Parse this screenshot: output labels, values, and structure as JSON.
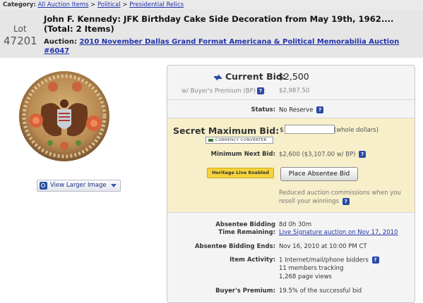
{
  "breadcrumb": {
    "label": "Category:",
    "items": [
      "All Auction Items",
      "Political",
      "Presidential Relics"
    ],
    "separator": ">"
  },
  "lot": {
    "label": "Lot",
    "number": "47201",
    "title": "John F. Kennedy: JFK Birthday Cake Side Decoration from May 19th, 1962.... (Total: 2 Items)",
    "auction_label": "Auction:",
    "auction_name": "2010 November Dallas Grand Format Americana & Political Memorabilia Auction #6047"
  },
  "image": {
    "view_larger_label": "View Larger Image"
  },
  "bid": {
    "current_label": "Current Bid:",
    "current_value": "$2,500",
    "bp_label": "w/ Buyer's Premium (BP)",
    "bp_value": "$2,987.50",
    "status_label": "Status:",
    "status_value": "No Reserve",
    "secret_label": "Secret Maximum Bid:",
    "dollar_sign": "$",
    "secret_input_value": "",
    "whole_dollars": "(whole dollars)",
    "currency_converter": "CURRENCY CONVERTER",
    "min_label": "Minimum Next Bid:",
    "min_value": "$2,600 ($3,107.00 w/ BP)",
    "heritage_live": "Heritage Live Enabled",
    "place_bid_button": "Place Absentee Bid",
    "reduced_commission": "Reduced auction commissions when you resell your winnings",
    "absentee_label_1": "Absentee Bidding",
    "absentee_label_2": "Time Remaining:",
    "absentee_value": "8d 0h 30m",
    "live_link": "Live Signature auction on Nov 17, 2010",
    "ends_label": "Absentee Bidding Ends:",
    "ends_value": "Nov 16, 2010 at 10:00 PM CT",
    "activity_label": "Item Activity:",
    "activity_bidders": "1 Internet/mail/phone bidders",
    "activity_tracking": "11 members tracking",
    "activity_views": "1,268 page views",
    "bp2_label": "Buyer's Premium:",
    "bp2_value": "19.5% of the successful bid",
    "help_glyph": "?"
  },
  "colors": {
    "link": "#2233aa",
    "secret_section_bg": "#f7efc9",
    "heritage_badge": "#f5d33b",
    "help_icon": "#2b4aa6"
  }
}
